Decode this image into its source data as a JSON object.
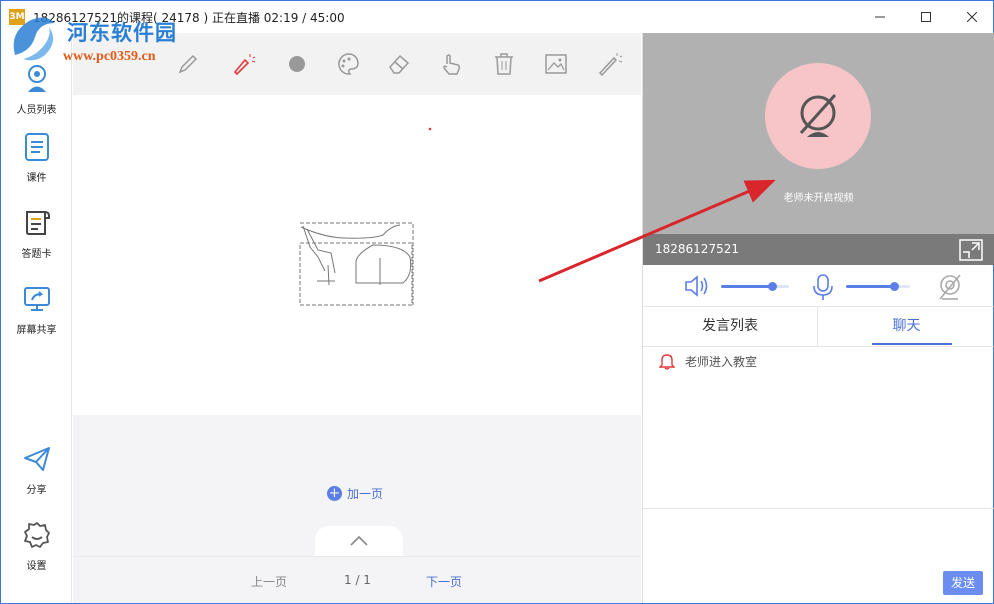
{
  "window": {
    "icon_text": "3M",
    "title": "18286127521的课程( 24178 ) 正在直播  02:19 / 45:00"
  },
  "watermark": {
    "title": "河东软件园",
    "url": "www.pc0359.cn"
  },
  "sidebar": {
    "items": [
      {
        "label": "人员列表",
        "icon": "user-list-icon"
      },
      {
        "label": "课件",
        "icon": "courseware-icon"
      },
      {
        "label": "答题卡",
        "icon": "answer-card-icon"
      },
      {
        "label": "屏幕共享",
        "icon": "screen-share-icon"
      },
      {
        "label": "分享",
        "icon": "paper-plane-icon"
      },
      {
        "label": "设置",
        "icon": "gear-icon"
      }
    ]
  },
  "toolbar": {
    "tools": [
      "pen-icon",
      "laser-pointer-icon",
      "dot-icon",
      "palette-icon",
      "eraser-icon",
      "hand-icon",
      "trash-icon",
      "image-icon",
      "magic-wand-icon"
    ],
    "active_tool": "laser-pointer-icon"
  },
  "board": {
    "add_page_label": "加一页"
  },
  "pager": {
    "prev": "上一页",
    "page": "1 / 1",
    "next": "下一页"
  },
  "video": {
    "status": "老师未开启视频",
    "user_name": "18286127521"
  },
  "audio": {
    "speaker_level": 0.75,
    "mic_level": 0.75
  },
  "tabs": [
    "发言列表",
    "聊天"
  ],
  "active_tab": "聊天",
  "chat": {
    "messages": [
      "老师进入教室"
    ]
  },
  "send_label": "发送",
  "colors": {
    "accent": "#4a6fd6",
    "laser": "#e23a3a",
    "video_bg": "#b1b1b1",
    "cam_circle": "#f7c5c8"
  }
}
